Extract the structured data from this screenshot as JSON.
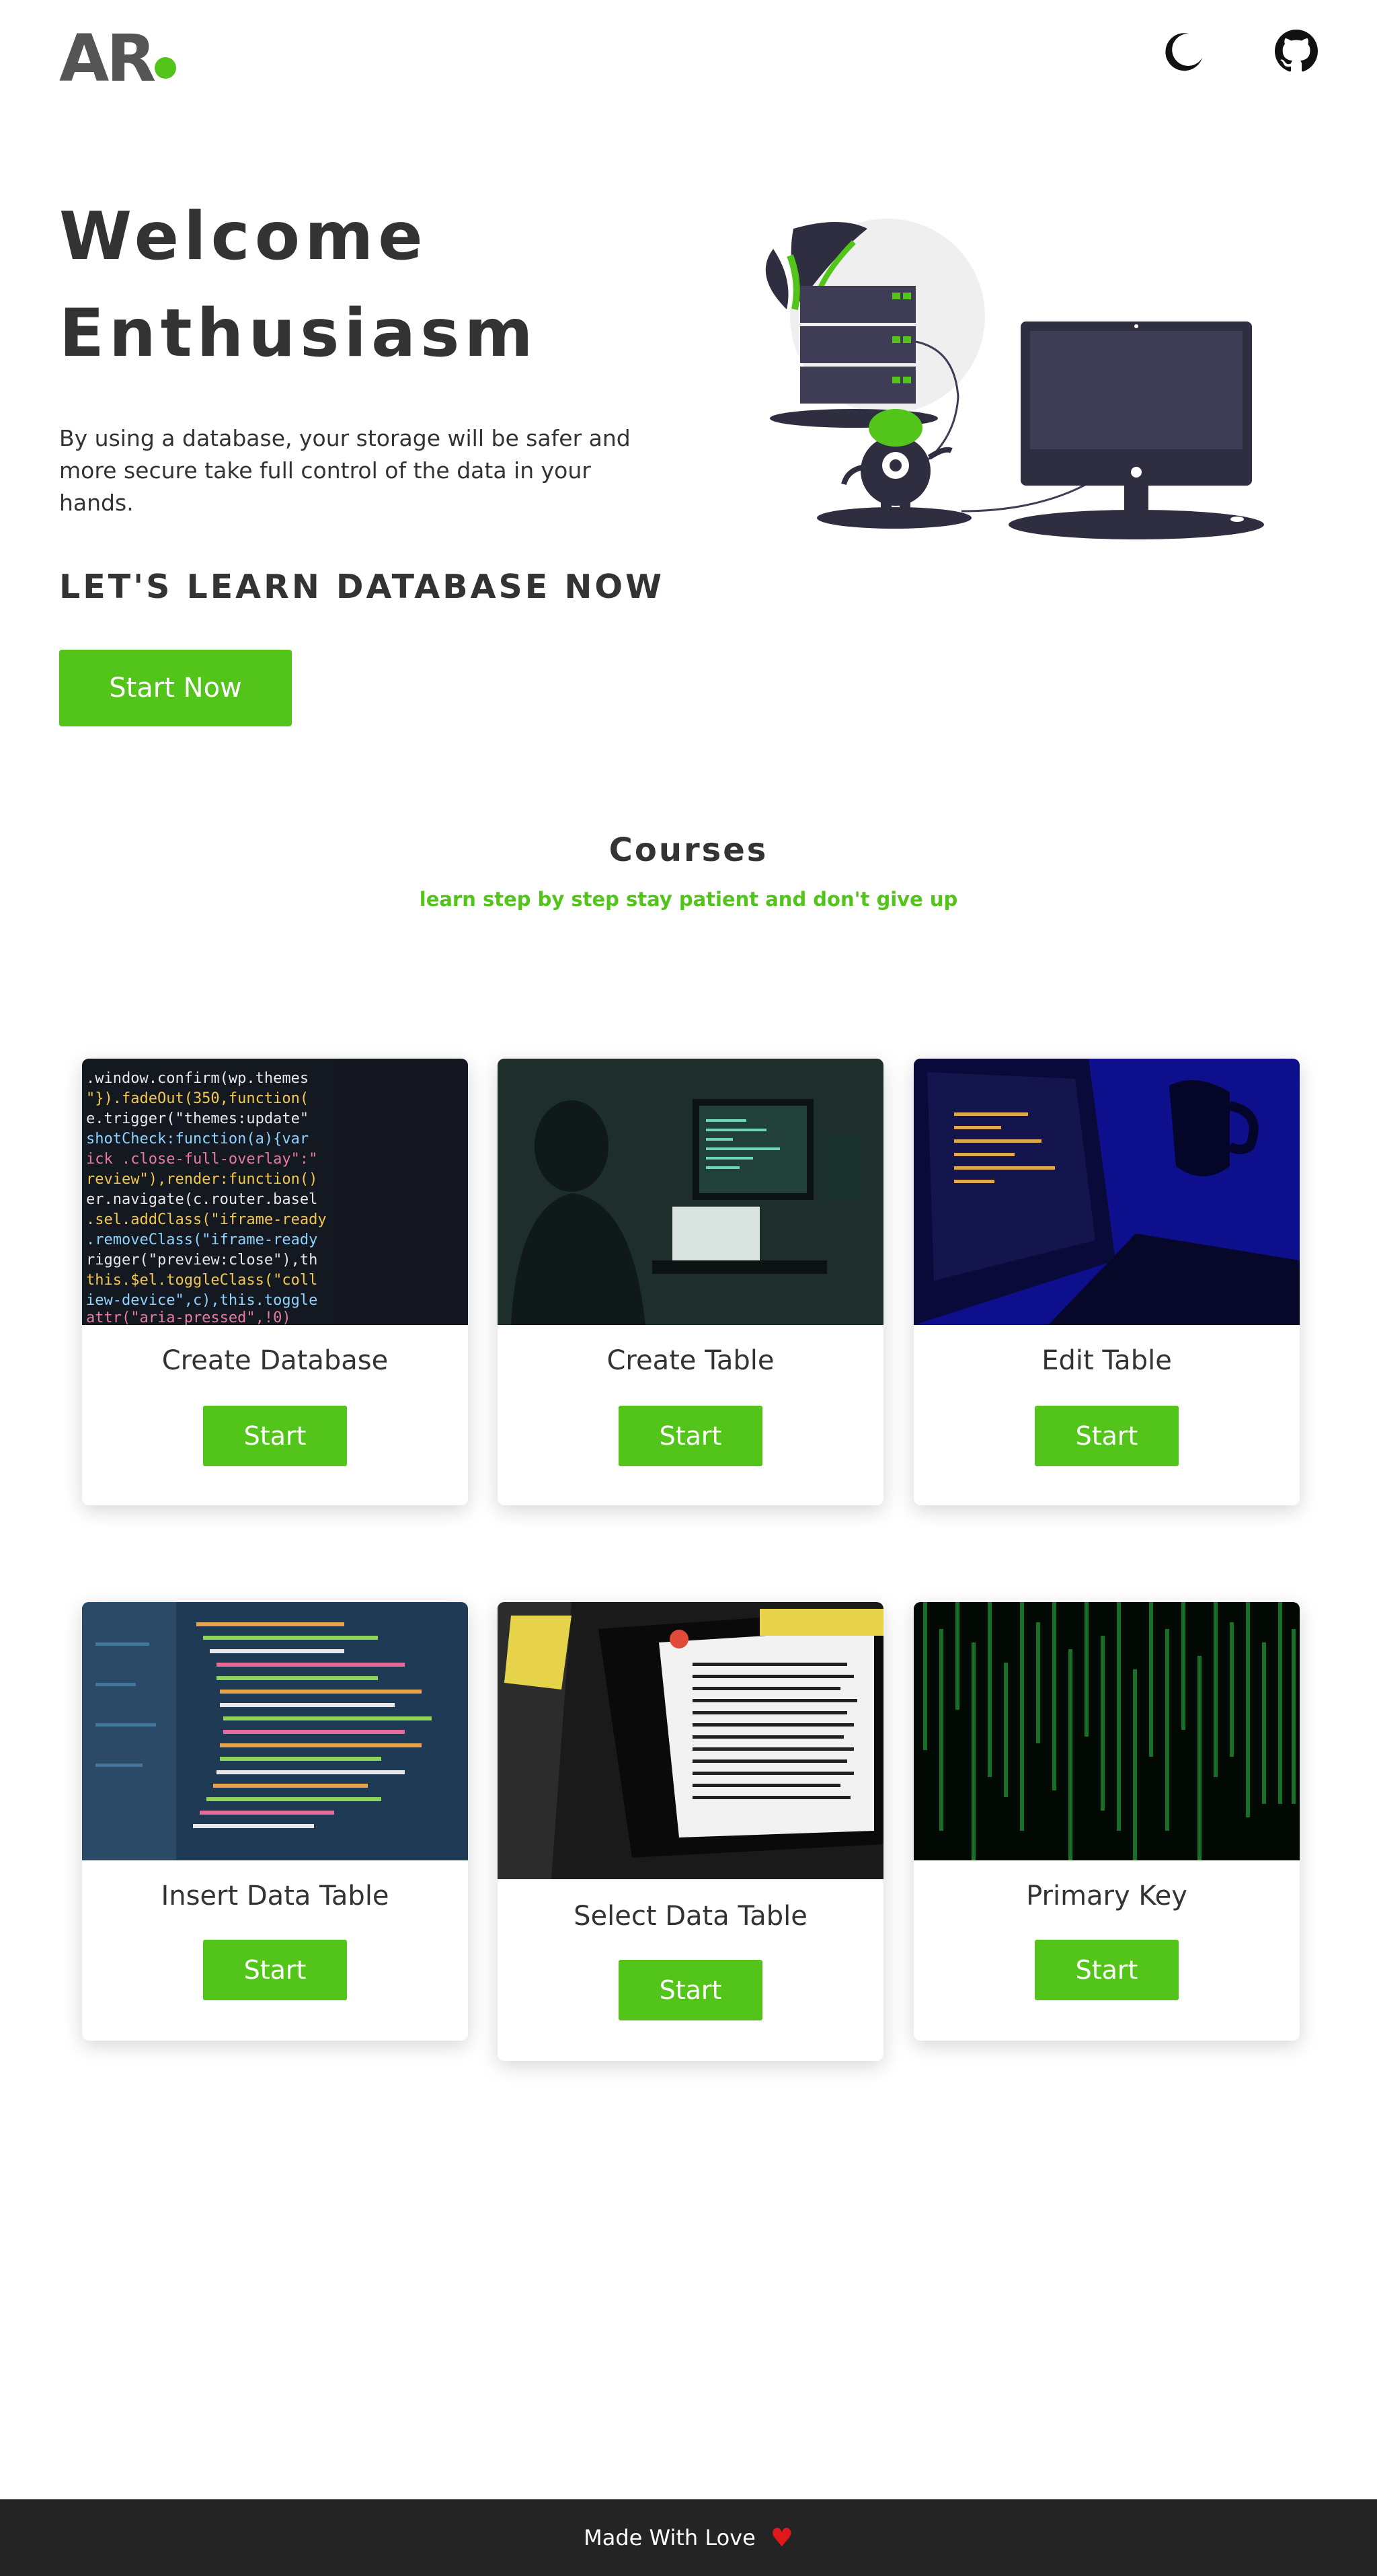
{
  "header": {
    "logo_text": "AR",
    "icons": {
      "theme": "moon-icon",
      "github": "github-icon"
    }
  },
  "hero": {
    "title_line1": "Welcome",
    "title_line2": "Enthusiasm",
    "description": "By using a database, your storage will be safer and more secure take full control of the data in your hands.",
    "cta_text": "LET'S LEARN DATABASE NOW",
    "button_label": "Start Now"
  },
  "courses": {
    "title": "Courses",
    "subtitle": "learn step by step stay patient and don't give up",
    "items": [
      {
        "title": "Create Database",
        "button": "Start"
      },
      {
        "title": "Create Table",
        "button": "Start"
      },
      {
        "title": "Edit Table",
        "button": "Start"
      },
      {
        "title": "Insert Data Table",
        "button": "Start"
      },
      {
        "title": "Select Data Table",
        "button": "Start"
      },
      {
        "title": "Primary Key",
        "button": "Start"
      }
    ]
  },
  "footer": {
    "text": "Made With Love",
    "icon": "heart-icon"
  },
  "colors": {
    "accent": "#52c41a",
    "dark": "#333333",
    "footer_bg": "#242424",
    "heart": "#e0181b"
  }
}
